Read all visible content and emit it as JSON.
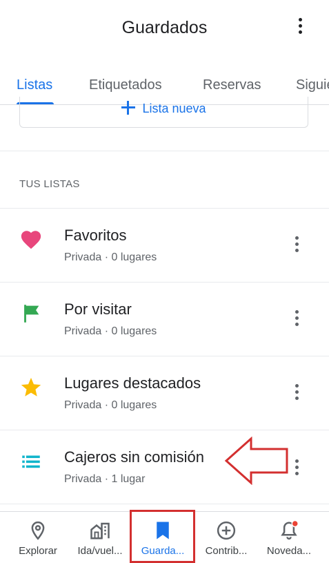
{
  "header": {
    "title": "Guardados"
  },
  "tabs": [
    {
      "label": "Listas",
      "active": true
    },
    {
      "label": "Etiquetados",
      "active": false
    },
    {
      "label": "Reservas",
      "active": false
    },
    {
      "label": "Siguie",
      "active": false
    }
  ],
  "new_list": {
    "label": "Lista nueva"
  },
  "section": {
    "title": "TUS LISTAS"
  },
  "lists": [
    {
      "icon": "heart-icon",
      "title": "Favoritos",
      "subtitle": "Privada · 0 lugares",
      "color": "#e8467c"
    },
    {
      "icon": "flag-icon",
      "title": "Por visitar",
      "subtitle": "Privada · 0 lugares",
      "color": "#34a853"
    },
    {
      "icon": "star-icon",
      "title": "Lugares destacados",
      "subtitle": "Privada · 0 lugares",
      "color": "#fbbc04"
    },
    {
      "icon": "list-icon",
      "title": "Cajeros sin comisión",
      "subtitle": "Privada · 1 lugar",
      "color": "#12b5cb"
    }
  ],
  "bottom_nav": [
    {
      "icon": "location-pin-icon",
      "label": "Explorar",
      "active": false
    },
    {
      "icon": "commute-icon",
      "label": "Ida/vuel...",
      "active": false
    },
    {
      "icon": "bookmark-icon",
      "label": "Guarda...",
      "active": true
    },
    {
      "icon": "add-circle-icon",
      "label": "Contrib...",
      "active": false
    },
    {
      "icon": "notifications-icon",
      "label": "Noveda...",
      "active": false,
      "badge": true
    }
  ],
  "colors": {
    "accent": "#1a73e8",
    "annotation": "#d32f2f",
    "badge": "#ea4335"
  }
}
